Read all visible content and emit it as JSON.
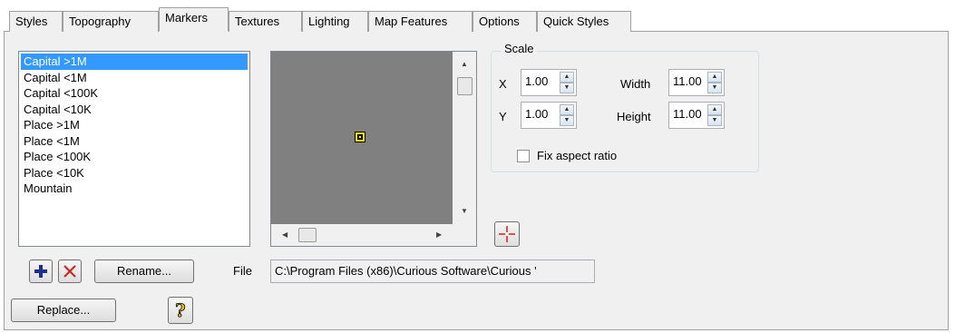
{
  "tabs": [
    {
      "label": "Styles",
      "active": false
    },
    {
      "label": "Topography",
      "active": false
    },
    {
      "label": "Markers",
      "active": true
    },
    {
      "label": "Textures",
      "active": false
    },
    {
      "label": "Lighting",
      "active": false
    },
    {
      "label": "Map Features",
      "active": false
    },
    {
      "label": "Options",
      "active": false
    },
    {
      "label": "Quick Styles",
      "active": false
    }
  ],
  "markers_list": {
    "items": [
      "Capital >1M",
      "Capital <1M",
      "Capital <100K",
      "Capital <10K",
      "Place >1M",
      "Place <1M",
      "Place <100K",
      "Place <10K",
      "Mountain"
    ],
    "selected": "Capital >1M"
  },
  "preview": {
    "background_color": "#808080",
    "marker_color": "#ffee00"
  },
  "scale": {
    "title": "Scale",
    "x_label": "X",
    "x_value": "1.00",
    "y_label": "Y",
    "y_value": "1.00",
    "width_label": "Width",
    "width_value": "11.00",
    "height_label": "Height",
    "height_value": "11.00",
    "fix_aspect_label": "Fix aspect ratio",
    "fix_aspect_checked": false
  },
  "buttons": {
    "add_icon": "plus-icon",
    "delete_icon": "delete-x-icon",
    "rename_label": "Rename...",
    "replace_label": "Replace...",
    "help_icon": "help-icon",
    "center_icon": "crosshair-icon"
  },
  "file": {
    "label": "File",
    "path": "C:\\Program Files (x86)\\Curious Software\\Curious '"
  }
}
